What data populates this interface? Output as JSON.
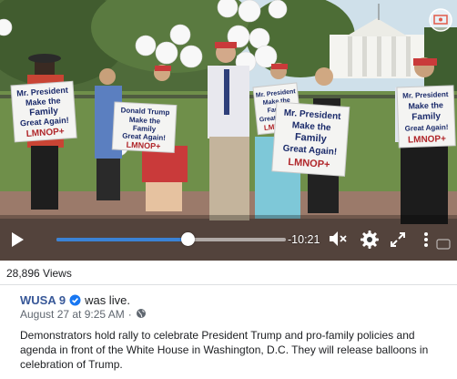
{
  "player": {
    "time_remaining": "-10:21",
    "progress_fraction": 0.57,
    "colors": {
      "progress": "#3b83d6",
      "controls": "#ffffff"
    },
    "icons": {
      "play": "play-icon",
      "volume": "volume-muted-icon",
      "settings": "gear-icon",
      "fullscreen": "expand-icon",
      "more": "more-vertical-icon"
    }
  },
  "scene": {
    "signs": [
      {
        "lines": [
          "Mr. President",
          "Make the",
          "Family",
          "Great Again!",
          "LMNOP+"
        ]
      },
      {
        "lines": [
          "Donald Trump",
          "Make the",
          "Family",
          "Great Again!",
          "LMNOP+"
        ]
      },
      {
        "lines": [
          "Mr. President",
          "Make the",
          "Family",
          "Great Again!",
          "LMNOP+"
        ]
      },
      {
        "lines": [
          "Mr. President",
          "Make the",
          "Family",
          "Great Again!",
          "LMNOP+"
        ]
      },
      {
        "lines": [
          "Mr. President",
          "Make the",
          "Family",
          "Great Again!",
          "LMNOP+"
        ]
      }
    ]
  },
  "stats": {
    "views": "28,896 Views"
  },
  "post": {
    "page_name": "WUSA 9",
    "live_text": "was live.",
    "date": "August 27 at 9:25 AM",
    "separator": "·",
    "description": "Demonstrators hold rally to celebrate President Trump and pro-family policies and agenda in front of the White House in Washington, D.C. They will release balloons in celebration of Trump."
  },
  "colors": {
    "link": "#385898",
    "verified": "#1877f2",
    "meta": "#606770"
  }
}
